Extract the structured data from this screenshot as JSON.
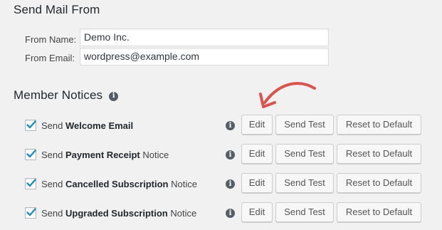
{
  "send_from": {
    "title": "Send Mail From",
    "name_label": "From Name:",
    "name_value": "Demo Inc.",
    "email_label": "From Email:",
    "email_value": "wordpress@example.com"
  },
  "member_notices": {
    "title": "Member Notices",
    "info_icon": "info-icon",
    "rows": [
      {
        "prefix": "Send",
        "bold": "Welcome Email",
        "suffix": "",
        "checked": true
      },
      {
        "prefix": "Send",
        "bold": "Payment Receipt",
        "suffix": "Notice",
        "checked": true
      },
      {
        "prefix": "Send",
        "bold": "Cancelled Subscription",
        "suffix": "Notice",
        "checked": true
      },
      {
        "prefix": "Send",
        "bold": "Upgraded Subscription",
        "suffix": "Notice",
        "checked": true
      }
    ],
    "buttons": {
      "edit": "Edit",
      "send_test": "Send Test",
      "reset": "Reset to Default"
    }
  },
  "colors": {
    "checkmark": "#1e8cbe",
    "annotation_arrow": "#d9534f"
  }
}
